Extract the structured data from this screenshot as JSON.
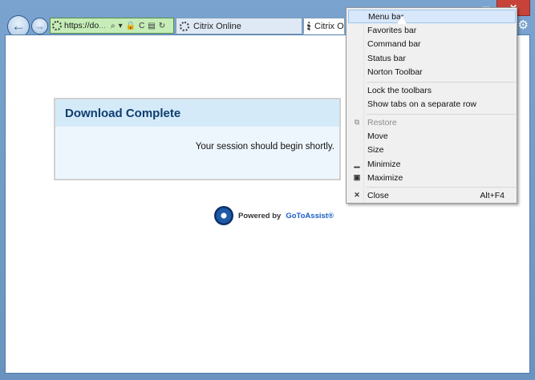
{
  "browser": {
    "address": {
      "url_visible": "https://do",
      "url_ellipsis": "...",
      "icons": [
        "search-icon",
        "dropdown-icon",
        "lock-icon",
        "c-icon",
        "compat-icon",
        "refresh-icon"
      ]
    },
    "tabs": [
      {
        "label": "Citrix Online",
        "icon": "loading-icon",
        "active": false
      },
      {
        "label": "Citrix On",
        "icon": "loading-icon",
        "active": true
      }
    ]
  },
  "page": {
    "heading": "Download Complete",
    "message": "Your session should begin shortly.",
    "powered_prefix": "Powered by",
    "powered_brand": "GoToAssist",
    "powered_mark": "®"
  },
  "context_menu": {
    "items": [
      {
        "label": "Menu bar",
        "state": "hover"
      },
      {
        "label": "Favorites bar"
      },
      {
        "label": "Command bar"
      },
      {
        "label": "Status bar"
      },
      {
        "label": "Norton Toolbar"
      },
      {
        "label": "Lock the toolbars"
      },
      {
        "label": "Show tabs on a separate row"
      },
      {
        "label": "Restore",
        "state": "disabled",
        "icon": "restore-icon"
      },
      {
        "label": "Move"
      },
      {
        "label": "Size"
      },
      {
        "label": "Minimize",
        "icon": "minimize-icon"
      },
      {
        "label": "Maximize",
        "icon": "maximize-icon"
      },
      {
        "label": "Close",
        "icon": "close-icon",
        "shortcut": "Alt+F4"
      }
    ]
  },
  "colors": {
    "frame": "#6a93c0",
    "address_bg": "#c6ecb8",
    "heading": "#0f3d6e",
    "brand": "#1a5fc4",
    "close_button": "#c7433a"
  }
}
